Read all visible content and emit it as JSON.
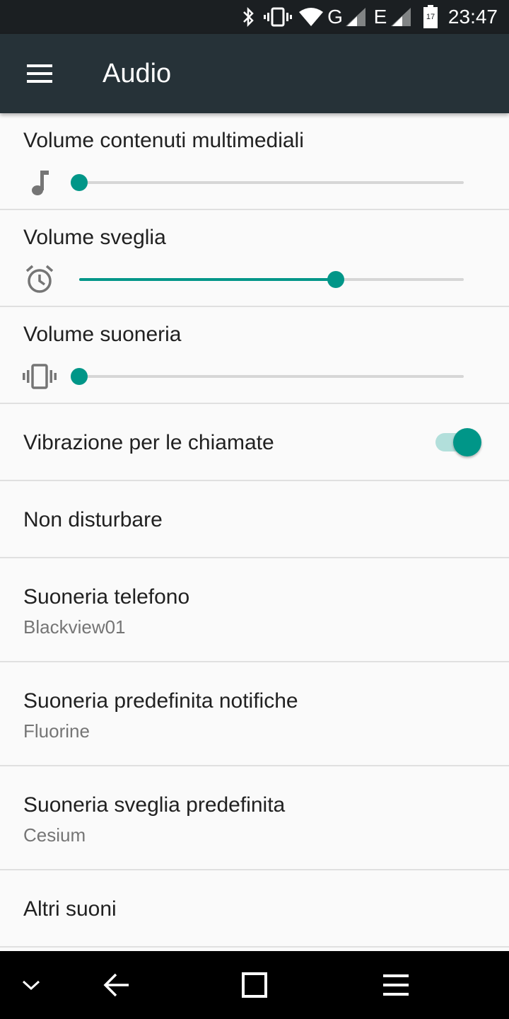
{
  "status_bar": {
    "time": "23:47",
    "network_1": "G",
    "network_2": "E",
    "battery_level": "17",
    "icons": [
      "bluetooth-icon",
      "vibrate-icon",
      "wifi-icon",
      "signal-icon",
      "signal-icon",
      "battery-icon"
    ]
  },
  "toolbar": {
    "title": "Audio",
    "menu_icon": "hamburger-menu-icon"
  },
  "volumes": [
    {
      "title": "Volume contenuti multimediali",
      "icon": "music-note-icon",
      "level": 0.0
    },
    {
      "title": "Volume sveglia",
      "icon": "alarm-clock-icon",
      "level": 0.667
    },
    {
      "title": "Volume suoneria",
      "icon": "vibrate-icon",
      "level": 0.0
    }
  ],
  "vibration_toggle": {
    "title": "Vibrazione per le chiamate",
    "checked": true
  },
  "do_not_disturb": {
    "title": "Non disturbare"
  },
  "ringtone": {
    "title": "Suoneria telefono",
    "value": "Blackview01"
  },
  "notification_sound": {
    "title": "Suoneria predefinita notifiche",
    "value": "Fluorine"
  },
  "alarm_sound": {
    "title": "Suoneria sveglia predefinita",
    "value": "Cesium"
  },
  "other_sounds": {
    "title": "Altri suoni"
  },
  "nav_bar": {
    "buttons": [
      "chevron-down-icon",
      "back-arrow-icon",
      "recents-square-icon",
      "menu-lines-icon"
    ]
  },
  "colors": {
    "accent": "#009688",
    "accent_light": "#b2dfdb",
    "toolbar": "#263238",
    "status_bar": "#1b1f22",
    "background": "#fafafa"
  }
}
